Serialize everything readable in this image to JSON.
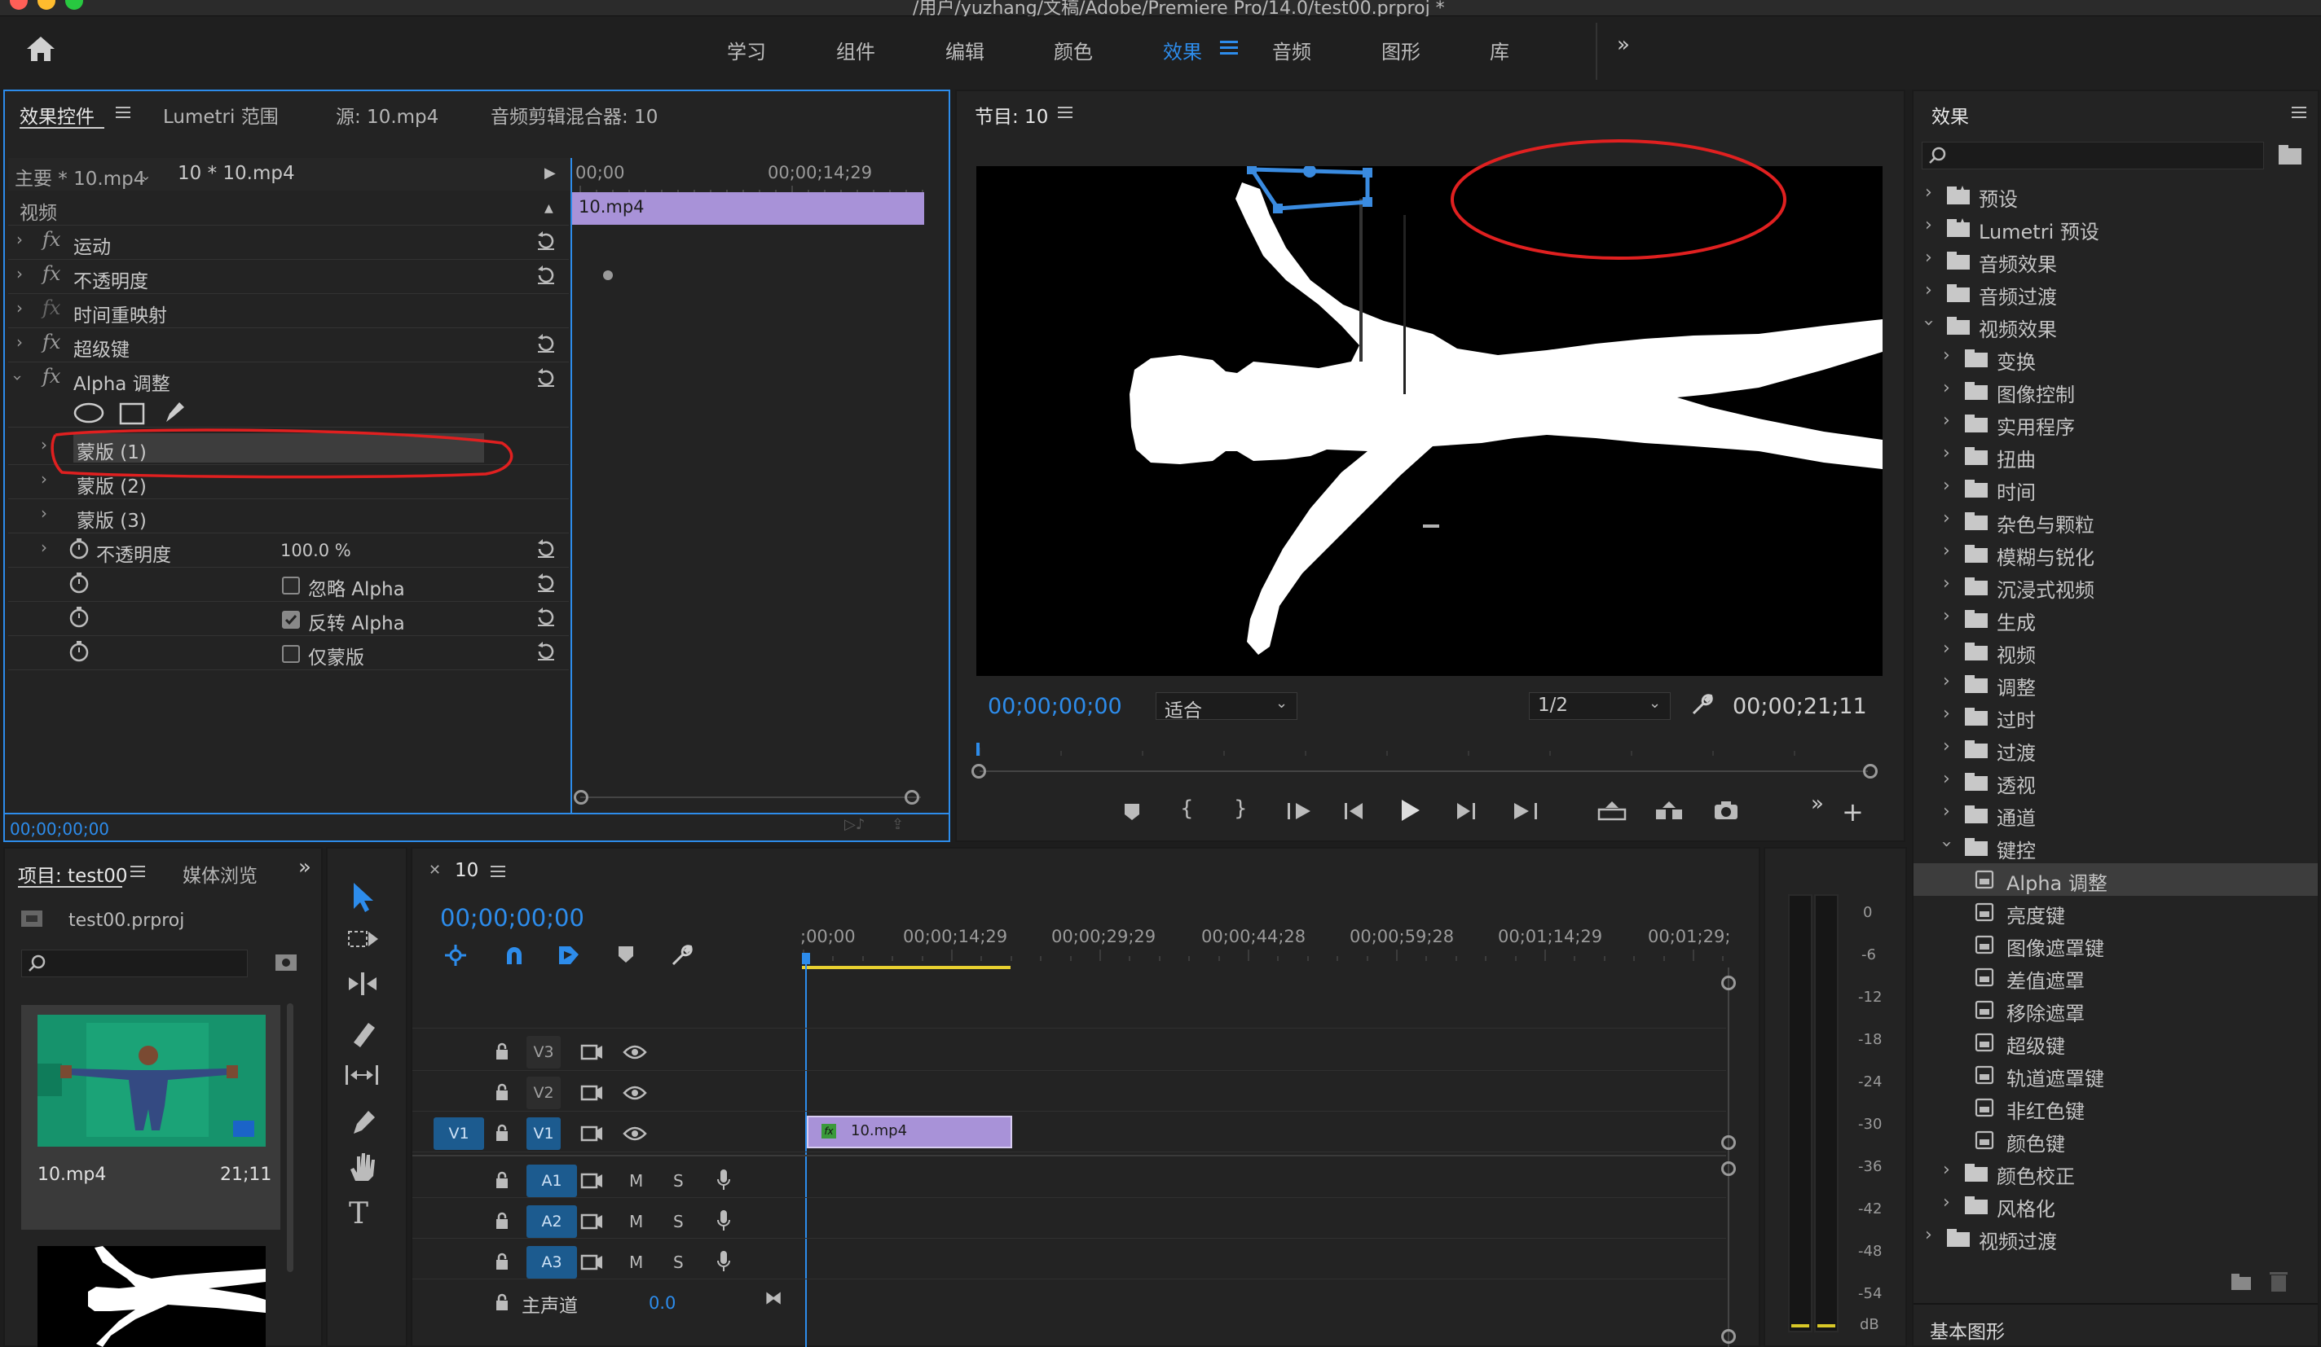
{
  "window": {
    "title": "/用户/yuzhang/文稿/Adobe/Premiere Pro/14.0/test00.prproj *"
  },
  "workspaces": [
    "学习",
    "组件",
    "编辑",
    "颜色",
    "效果",
    "音频",
    "图形",
    "库"
  ],
  "workspace_active": "效果",
  "effect_controls": {
    "tabs": [
      "效果控件",
      "Lumetri 范围",
      "源: 10.mp4",
      "音频剪辑混合器: 10"
    ],
    "master_label": "主要 * 10.mp4",
    "clip_label": "10 * 10.mp4",
    "timecode_start": "00;00",
    "timecode_mid": "00;00;14;29",
    "clip_bar": "10.mp4",
    "section": "视频",
    "rows": [
      "运动",
      "不透明度",
      "时间重映射",
      "超级键",
      "Alpha 调整"
    ],
    "masks": [
      "蒙版 (1)",
      "蒙版 (2)",
      "蒙版 (3)"
    ],
    "opacity_label": "不透明度",
    "opacity_value": "100.0 %",
    "checks": [
      {
        "label": "忽略 Alpha",
        "checked": false
      },
      {
        "label": "反转 Alpha",
        "checked": true
      },
      {
        "label": "仅蒙版",
        "checked": false
      }
    ],
    "footer_timecode": "00;00;00;00"
  },
  "program": {
    "title": "节目: 10",
    "timecode": "00;00;00;00",
    "fit": "适合",
    "resolution": "1/2",
    "duration": "00;00;21;11"
  },
  "effects_panel": {
    "title": "效果",
    "tree": [
      {
        "label": "预设",
        "level": 0,
        "kind": "special",
        "open": false
      },
      {
        "label": "Lumetri 预设",
        "level": 0,
        "kind": "special",
        "open": false
      },
      {
        "label": "音频效果",
        "level": 0,
        "kind": "folder",
        "open": false
      },
      {
        "label": "音频过渡",
        "level": 0,
        "kind": "folder",
        "open": false
      },
      {
        "label": "视频效果",
        "level": 0,
        "kind": "folder",
        "open": true
      },
      {
        "label": "变换",
        "level": 1,
        "kind": "folder",
        "open": false
      },
      {
        "label": "图像控制",
        "level": 1,
        "kind": "folder",
        "open": false
      },
      {
        "label": "实用程序",
        "level": 1,
        "kind": "folder",
        "open": false
      },
      {
        "label": "扭曲",
        "level": 1,
        "kind": "folder",
        "open": false
      },
      {
        "label": "时间",
        "level": 1,
        "kind": "folder",
        "open": false
      },
      {
        "label": "杂色与颗粒",
        "level": 1,
        "kind": "folder",
        "open": false
      },
      {
        "label": "模糊与锐化",
        "level": 1,
        "kind": "folder",
        "open": false
      },
      {
        "label": "沉浸式视频",
        "level": 1,
        "kind": "folder",
        "open": false
      },
      {
        "label": "生成",
        "level": 1,
        "kind": "folder",
        "open": false
      },
      {
        "label": "视频",
        "level": 1,
        "kind": "folder",
        "open": false
      },
      {
        "label": "调整",
        "level": 1,
        "kind": "folder",
        "open": false
      },
      {
        "label": "过时",
        "level": 1,
        "kind": "folder",
        "open": false
      },
      {
        "label": "过渡",
        "level": 1,
        "kind": "folder",
        "open": false
      },
      {
        "label": "透视",
        "level": 1,
        "kind": "folder",
        "open": false
      },
      {
        "label": "通道",
        "level": 1,
        "kind": "folder",
        "open": false
      },
      {
        "label": "键控",
        "level": 1,
        "kind": "folder",
        "open": true
      },
      {
        "label": "Alpha 调整",
        "level": 2,
        "kind": "effect",
        "selected": true
      },
      {
        "label": "亮度键",
        "level": 2,
        "kind": "effect"
      },
      {
        "label": "图像遮罩键",
        "level": 2,
        "kind": "effect"
      },
      {
        "label": "差值遮罩",
        "level": 2,
        "kind": "effect"
      },
      {
        "label": "移除遮罩",
        "level": 2,
        "kind": "effect"
      },
      {
        "label": "超级键",
        "level": 2,
        "kind": "effect"
      },
      {
        "label": "轨道遮罩键",
        "level": 2,
        "kind": "effect"
      },
      {
        "label": "非红色键",
        "level": 2,
        "kind": "effect"
      },
      {
        "label": "颜色键",
        "level": 2,
        "kind": "effect"
      },
      {
        "label": "颜色校正",
        "level": 1,
        "kind": "folder",
        "open": false
      },
      {
        "label": "风格化",
        "level": 1,
        "kind": "folder",
        "open": false
      },
      {
        "label": "视频过渡",
        "level": 0,
        "kind": "folder",
        "open": false
      }
    ],
    "footer": "基本图形"
  },
  "project": {
    "tabs": [
      "项目: test00",
      "媒体浏览"
    ],
    "file": "test00.prproj",
    "items": [
      {
        "name": "10.mp4",
        "duration": "21;11"
      }
    ]
  },
  "timeline": {
    "tab": "10",
    "timecode": "00;00;00;00",
    "ruler": [
      ";00;00",
      "00;00;14;29",
      "00;00;29;29",
      "00;00;44;28",
      "00;00;59;28",
      "00;01;14;29",
      "00;01;29;"
    ],
    "video_tracks": [
      "V3",
      "V2",
      "V1"
    ],
    "audio_tracks": [
      "A1",
      "A2",
      "A3"
    ],
    "source_patch": "V1",
    "clip": "10.mp4",
    "master_label": "主声道",
    "master_value": "0.0"
  },
  "meter": {
    "labels": [
      "0",
      "-6",
      "-12",
      "-18",
      "-24",
      "-30",
      "-36",
      "-42",
      "-48",
      "-54",
      "dB"
    ]
  },
  "colors": {
    "accent": "#2d8ceb",
    "clip": "#a892d8",
    "annotation": "#e02020",
    "mask": "#3a8be0"
  }
}
